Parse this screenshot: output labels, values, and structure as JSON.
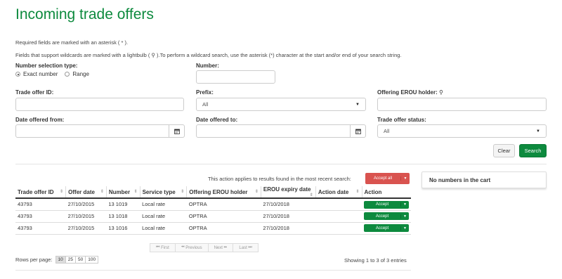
{
  "page": {
    "title": "Incoming trade offers"
  },
  "notes": {
    "required": "Required fields are marked with an asterisk ( * ).",
    "wildcard": "Fields that support wildcards are marked with a lightbulb ( ).To perform a wildcard search, use the asterisk (*) character at the start and/or end of your search string."
  },
  "form": {
    "number_selection_type": {
      "label": "Number selection type:",
      "options": [
        "Exact number",
        "Range"
      ],
      "selected": "Exact number"
    },
    "number": {
      "label": "Number:",
      "value": ""
    },
    "trade_offer_id": {
      "label": "Trade offer ID:",
      "value": ""
    },
    "prefix": {
      "label": "Prefix:",
      "value": "All"
    },
    "offering_erou_holder": {
      "label": "Offering EROU holder:",
      "value": ""
    },
    "date_offered_from": {
      "label": "Date offered from:",
      "value": ""
    },
    "date_offered_to": {
      "label": "Date offered to:",
      "value": ""
    },
    "trade_offer_status": {
      "label": "Trade offer status:",
      "value": "All"
    },
    "clear_label": "Clear",
    "search_label": "Search"
  },
  "results": {
    "applies_note": "This action applies to results found in the most recent search:",
    "accept_all_label": "Accept all",
    "columns": [
      "Trade offer ID",
      "Offer date",
      "Number",
      "Service type",
      "Offering EROU holder",
      "EROU expiry date",
      "Action date",
      "Action"
    ],
    "rows": [
      [
        "43793",
        "27/10/2015",
        "13 1019",
        "Local rate",
        "OPTRA",
        "27/10/2018",
        "",
        "Accept"
      ],
      [
        "43793",
        "27/10/2015",
        "13 1018",
        "Local rate",
        "OPTRA",
        "27/10/2018",
        "",
        "Accept"
      ],
      [
        "43793",
        "27/10/2015",
        "13 1016",
        "Local rate",
        "OPTRA",
        "27/10/2018",
        "",
        "Accept"
      ]
    ],
    "pager": [
      "First",
      "Previous",
      "Next",
      "Last"
    ],
    "rows_per_page_label": "Rows per page:",
    "rows_per_page_options": [
      "10",
      "25",
      "50",
      "100"
    ],
    "rows_per_page_selected": "10",
    "showing": "Showing 1 to 3 of 3 entries"
  },
  "cart": {
    "empty_text": "No numbers in the cart"
  },
  "colors": {
    "brand_green": "#0d8a3e",
    "danger_red": "#d9534f"
  }
}
